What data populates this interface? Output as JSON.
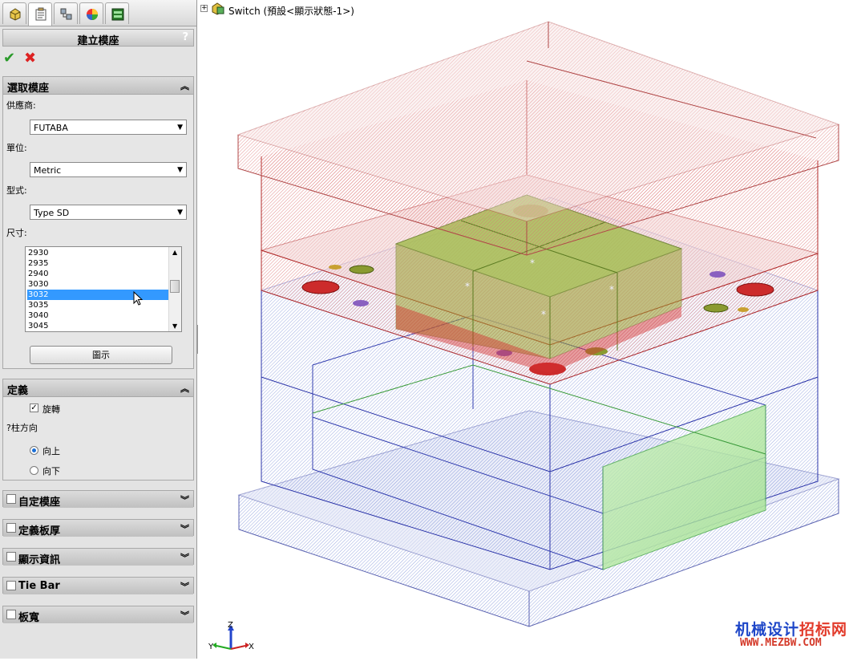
{
  "tabs": [
    {
      "icon": "feature-manager-icon"
    },
    {
      "icon": "property-manager-icon"
    },
    {
      "icon": "configuration-manager-icon"
    },
    {
      "icon": "display-manager-icon"
    },
    {
      "icon": "mold-base-icon"
    }
  ],
  "panel": {
    "title": "建立模座",
    "help": "?",
    "ok_icon": "✔",
    "cancel_icon": "✖"
  },
  "select_section": {
    "title": "選取模座",
    "supplier_label": "供應商:",
    "supplier_value": "FUTABA",
    "unit_label": "單位:",
    "unit_value": "Metric",
    "type_label": "型式:",
    "type_value": "Type SD",
    "size_label": "尺寸:",
    "sizes": [
      "2930",
      "2935",
      "2940",
      "3030",
      "3032",
      "3035",
      "3040",
      "3045"
    ],
    "selected_size": "3032",
    "show_button": "圖示"
  },
  "define_section": {
    "title": "定義",
    "rotate_label": "旋轉",
    "rotate_checked": true,
    "direction_label": "?柱方向",
    "up_label": "向上",
    "down_label": "向下",
    "direction_selected": "向上"
  },
  "collapsed_sections": [
    {
      "title": "自定模座"
    },
    {
      "title": "定義板厚"
    },
    {
      "title": "顯示資訊"
    },
    {
      "title": "Tie Bar"
    },
    {
      "title": "板寬"
    }
  ],
  "tree": {
    "node_text": "Switch (預設<顯示狀態-1>)"
  },
  "triad": {
    "x": "X",
    "y": "Y",
    "z": "Z"
  },
  "watermark": {
    "line1_a": "机械设计",
    "line1_b": "招标网",
    "line2": "WWW.MEZBW.COM"
  },
  "colors": {
    "accent_red": "#cc2222",
    "accent_blue": "#2233aa",
    "accent_green": "#33aa33",
    "selection": "#3399ff"
  }
}
